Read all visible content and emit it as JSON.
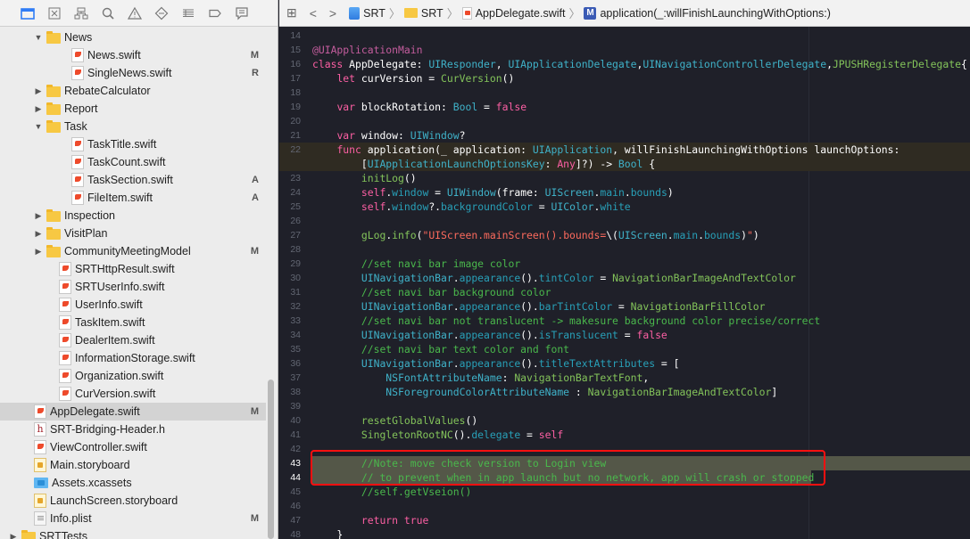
{
  "navigator": {
    "toolbar_icons": [
      {
        "name": "project-navigator-icon",
        "active": true
      },
      {
        "name": "source-control-navigator-icon",
        "active": false
      },
      {
        "name": "symbol-navigator-icon",
        "active": false
      },
      {
        "name": "find-navigator-icon",
        "active": false
      },
      {
        "name": "issue-navigator-icon",
        "active": false
      },
      {
        "name": "test-navigator-icon",
        "active": false
      },
      {
        "name": "debug-navigator-icon",
        "active": false
      },
      {
        "name": "breakpoint-navigator-icon",
        "active": false
      },
      {
        "name": "report-navigator-icon",
        "active": false
      }
    ],
    "items": [
      {
        "label": "News",
        "type": "folder",
        "indent": 1,
        "expanded": true,
        "status": ""
      },
      {
        "label": "News.swift",
        "type": "swift",
        "indent": 2,
        "status": "M"
      },
      {
        "label": "SingleNews.swift",
        "type": "swift",
        "indent": 2,
        "status": "R"
      },
      {
        "label": "RebateCalculator",
        "type": "folder",
        "indent": 1,
        "expanded": false,
        "status": ""
      },
      {
        "label": "Report",
        "type": "folder",
        "indent": 1,
        "expanded": false,
        "status": ""
      },
      {
        "label": "Task",
        "type": "folder",
        "indent": 1,
        "expanded": true,
        "status": ""
      },
      {
        "label": "TaskTitle.swift",
        "type": "swift",
        "indent": 2,
        "status": ""
      },
      {
        "label": "TaskCount.swift",
        "type": "swift",
        "indent": 2,
        "status": ""
      },
      {
        "label": "TaskSection.swift",
        "type": "swift",
        "indent": 2,
        "status": "A"
      },
      {
        "label": "FileItem.swift",
        "type": "swift",
        "indent": 2,
        "status": "A"
      },
      {
        "label": "Inspection",
        "type": "folder",
        "indent": 1,
        "expanded": false,
        "status": ""
      },
      {
        "label": "VisitPlan",
        "type": "folder",
        "indent": 1,
        "expanded": false,
        "status": ""
      },
      {
        "label": "CommunityMeetingModel",
        "type": "folder",
        "indent": 1,
        "expanded": false,
        "status": "M"
      },
      {
        "label": "SRTHttpResult.swift",
        "type": "swift",
        "indent": 1.5,
        "status": ""
      },
      {
        "label": "SRTUserInfo.swift",
        "type": "swift",
        "indent": 1.5,
        "status": ""
      },
      {
        "label": "UserInfo.swift",
        "type": "swift",
        "indent": 1.5,
        "status": ""
      },
      {
        "label": "TaskItem.swift",
        "type": "swift",
        "indent": 1.5,
        "status": ""
      },
      {
        "label": "DealerItem.swift",
        "type": "swift",
        "indent": 1.5,
        "status": ""
      },
      {
        "label": "InformationStorage.swift",
        "type": "swift",
        "indent": 1.5,
        "status": ""
      },
      {
        "label": "Organization.swift",
        "type": "swift",
        "indent": 1.5,
        "status": ""
      },
      {
        "label": "CurVersion.swift",
        "type": "swift",
        "indent": 1.5,
        "status": ""
      },
      {
        "label": "AppDelegate.swift",
        "type": "swift",
        "indent": 0.5,
        "status": "M",
        "selected": true
      },
      {
        "label": "SRT-Bridging-Header.h",
        "type": "header",
        "indent": 0.5,
        "status": ""
      },
      {
        "label": "ViewController.swift",
        "type": "swift",
        "indent": 0.5,
        "status": ""
      },
      {
        "label": "Main.storyboard",
        "type": "storyboard",
        "indent": 0.5,
        "status": ""
      },
      {
        "label": "Assets.xcassets",
        "type": "assets",
        "indent": 0.5,
        "status": ""
      },
      {
        "label": "LaunchScreen.storyboard",
        "type": "storyboard",
        "indent": 0.5,
        "status": ""
      },
      {
        "label": "Info.plist",
        "type": "plist",
        "indent": 0.5,
        "status": "M"
      },
      {
        "label": "SRTTests",
        "type": "folder",
        "indent": 0,
        "expanded": false,
        "status": ""
      }
    ]
  },
  "jump_bar": {
    "back": "<",
    "forward": ">",
    "crumbs": [
      {
        "label": "SRT",
        "icon": "project-icon"
      },
      {
        "label": "SRT",
        "icon": "folder-icon"
      },
      {
        "label": "AppDelegate.swift",
        "icon": "swift-file-icon"
      },
      {
        "label": "application(_:willFinishLaunchingWithOptions:)",
        "icon": "method-icon",
        "badge": "M"
      }
    ]
  },
  "editor": {
    "lines": [
      {
        "n": "14",
        "tokens": []
      },
      {
        "n": "15",
        "tokens": [
          [
            "at",
            "@UIApplicationMain"
          ]
        ]
      },
      {
        "n": "16",
        "tokens": [
          [
            "kw",
            "class"
          ],
          [
            "pl",
            " AppDelegate: "
          ],
          [
            "ty",
            "UIResponder"
          ],
          [
            "pl",
            ", "
          ],
          [
            "ty",
            "UIApplicationDelegate"
          ],
          [
            "pl",
            ","
          ],
          [
            "ty",
            "UINavigationControllerDelegate"
          ],
          [
            "pl",
            ","
          ],
          [
            "fn",
            "JPUSHRegisterDelegate"
          ],
          [
            "pl",
            "{"
          ]
        ]
      },
      {
        "n": "17",
        "tokens": [
          [
            "pl",
            "    "
          ],
          [
            "kw",
            "let"
          ],
          [
            "pl",
            " curVersion = "
          ],
          [
            "fn",
            "CurVersion"
          ],
          [
            "pl",
            "()"
          ]
        ]
      },
      {
        "n": "18",
        "tokens": []
      },
      {
        "n": "19",
        "tokens": [
          [
            "pl",
            "    "
          ],
          [
            "kw",
            "var"
          ],
          [
            "pl",
            " blockRotation: "
          ],
          [
            "ty",
            "Bool"
          ],
          [
            "pl",
            " = "
          ],
          [
            "kw",
            "false"
          ]
        ]
      },
      {
        "n": "20",
        "tokens": []
      },
      {
        "n": "21",
        "tokens": [
          [
            "pl",
            "    "
          ],
          [
            "kw",
            "var"
          ],
          [
            "pl",
            " window: "
          ],
          [
            "ty",
            "UIWindow"
          ],
          [
            "pl",
            "?"
          ]
        ]
      },
      {
        "n": "22",
        "current": true,
        "tokens": [
          [
            "pl",
            "    "
          ],
          [
            "kw",
            "func"
          ],
          [
            "pl",
            " application(_ application: "
          ],
          [
            "ty",
            "UIApplication"
          ],
          [
            "pl",
            ", willFinishLaunchingWithOptions launchOptions:"
          ]
        ]
      },
      {
        "n": "",
        "current": true,
        "tokens": [
          [
            "pl",
            "        ["
          ],
          [
            "ty",
            "UIApplicationLaunchOptionsKey"
          ],
          [
            "pl",
            ": "
          ],
          [
            "kw",
            "Any"
          ],
          [
            "pl",
            "]?) -> "
          ],
          [
            "ty",
            "Bool"
          ],
          [
            "pl",
            " {"
          ]
        ]
      },
      {
        "n": "23",
        "tokens": [
          [
            "pl",
            "        "
          ],
          [
            "fn",
            "initLog"
          ],
          [
            "pl",
            "()"
          ]
        ]
      },
      {
        "n": "24",
        "tokens": [
          [
            "pl",
            "        "
          ],
          [
            "kw",
            "self"
          ],
          [
            "pl",
            "."
          ],
          [
            "pr",
            "window"
          ],
          [
            "pl",
            " = "
          ],
          [
            "ty",
            "UIWindow"
          ],
          [
            "pl",
            "(frame: "
          ],
          [
            "ty",
            "UIScreen"
          ],
          [
            "pl",
            "."
          ],
          [
            "pr",
            "main"
          ],
          [
            "pl",
            "."
          ],
          [
            "pr",
            "bounds"
          ],
          [
            "pl",
            ")"
          ]
        ]
      },
      {
        "n": "25",
        "tokens": [
          [
            "pl",
            "        "
          ],
          [
            "kw",
            "self"
          ],
          [
            "pl",
            "."
          ],
          [
            "pr",
            "window"
          ],
          [
            "pl",
            "?."
          ],
          [
            "pr",
            "backgroundColor"
          ],
          [
            "pl",
            " = "
          ],
          [
            "ty",
            "UIColor"
          ],
          [
            "pl",
            "."
          ],
          [
            "pr",
            "white"
          ]
        ]
      },
      {
        "n": "26",
        "tokens": []
      },
      {
        "n": "27",
        "tokens": [
          [
            "pl",
            "        "
          ],
          [
            "fn",
            "gLog"
          ],
          [
            "pl",
            "."
          ],
          [
            "fn",
            "info"
          ],
          [
            "pl",
            "("
          ],
          [
            "st",
            "\"UIScreen.mainScreen().bounds="
          ],
          [
            "pl",
            "\\("
          ],
          [
            "ty",
            "UIScreen"
          ],
          [
            "pl",
            "."
          ],
          [
            "pr",
            "main"
          ],
          [
            "pl",
            "."
          ],
          [
            "pr",
            "bounds"
          ],
          [
            "pl",
            ")"
          ],
          [
            "st",
            "\""
          ],
          [
            "pl",
            ")"
          ]
        ]
      },
      {
        "n": "28",
        "tokens": []
      },
      {
        "n": "29",
        "tokens": [
          [
            "pl",
            "        "
          ],
          [
            "cm",
            "//set navi bar image color"
          ]
        ]
      },
      {
        "n": "30",
        "tokens": [
          [
            "pl",
            "        "
          ],
          [
            "ty",
            "UINavigationBar"
          ],
          [
            "pl",
            "."
          ],
          [
            "pr",
            "appearance"
          ],
          [
            "pl",
            "()."
          ],
          [
            "pr",
            "tintColor"
          ],
          [
            "pl",
            " = "
          ],
          [
            "fn",
            "NavigationBarImageAndTextColor"
          ]
        ]
      },
      {
        "n": "31",
        "tokens": [
          [
            "pl",
            "        "
          ],
          [
            "cm",
            "//set navi bar background color"
          ]
        ]
      },
      {
        "n": "32",
        "tokens": [
          [
            "pl",
            "        "
          ],
          [
            "ty",
            "UINavigationBar"
          ],
          [
            "pl",
            "."
          ],
          [
            "pr",
            "appearance"
          ],
          [
            "pl",
            "()."
          ],
          [
            "pr",
            "barTintColor"
          ],
          [
            "pl",
            " = "
          ],
          [
            "fn",
            "NavigationBarFillColor"
          ]
        ]
      },
      {
        "n": "33",
        "tokens": [
          [
            "pl",
            "        "
          ],
          [
            "cm",
            "//set navi bar not translucent -> makesure background color precise/correct"
          ]
        ]
      },
      {
        "n": "34",
        "tokens": [
          [
            "pl",
            "        "
          ],
          [
            "ty",
            "UINavigationBar"
          ],
          [
            "pl",
            "."
          ],
          [
            "pr",
            "appearance"
          ],
          [
            "pl",
            "()."
          ],
          [
            "pr",
            "isTranslucent"
          ],
          [
            "pl",
            " = "
          ],
          [
            "kw",
            "false"
          ]
        ]
      },
      {
        "n": "35",
        "tokens": [
          [
            "pl",
            "        "
          ],
          [
            "cm",
            "//set navi bar text color and font"
          ]
        ]
      },
      {
        "n": "36",
        "tokens": [
          [
            "pl",
            "        "
          ],
          [
            "ty",
            "UINavigationBar"
          ],
          [
            "pl",
            "."
          ],
          [
            "pr",
            "appearance"
          ],
          [
            "pl",
            "()."
          ],
          [
            "pr",
            "titleTextAttributes"
          ],
          [
            "pl",
            " = ["
          ]
        ]
      },
      {
        "n": "37",
        "tokens": [
          [
            "pl",
            "            "
          ],
          [
            "ty",
            "NSFontAttributeName"
          ],
          [
            "pl",
            ": "
          ],
          [
            "fn",
            "NavigationBarTextFont"
          ],
          [
            "pl",
            ","
          ]
        ]
      },
      {
        "n": "38",
        "tokens": [
          [
            "pl",
            "            "
          ],
          [
            "ty",
            "NSForegroundColorAttributeName"
          ],
          [
            "pl",
            " : "
          ],
          [
            "fn",
            "NavigationBarImageAndTextColor"
          ],
          [
            "pl",
            "]"
          ]
        ]
      },
      {
        "n": "39",
        "tokens": []
      },
      {
        "n": "40",
        "tokens": [
          [
            "pl",
            "        "
          ],
          [
            "fn",
            "resetGlobalValues"
          ],
          [
            "pl",
            "()"
          ]
        ]
      },
      {
        "n": "41",
        "tokens": [
          [
            "pl",
            "        "
          ],
          [
            "fn",
            "SingletonRootNC"
          ],
          [
            "pl",
            "()."
          ],
          [
            "pr",
            "delegate"
          ],
          [
            "pl",
            " = "
          ],
          [
            "kw",
            "self"
          ]
        ]
      },
      {
        "n": "42",
        "tokens": []
      },
      {
        "n": "43",
        "selected": "full",
        "tokens": [
          [
            "pl",
            "        "
          ],
          [
            "cm",
            "//Note: move check version to Login view"
          ]
        ]
      },
      {
        "n": "44",
        "selected": "partial",
        "tokens": [
          [
            "pl",
            "        "
          ],
          [
            "cm",
            "// to prevent when in app launch but no network, app will crash or stopped"
          ]
        ]
      },
      {
        "n": "45",
        "tokens": [
          [
            "pl",
            "        "
          ],
          [
            "cm",
            "//self.getVseion()"
          ]
        ]
      },
      {
        "n": "46",
        "tokens": []
      },
      {
        "n": "47",
        "tokens": [
          [
            "pl",
            "        "
          ],
          [
            "kw",
            "return"
          ],
          [
            "pl",
            " "
          ],
          [
            "kw",
            "true"
          ]
        ]
      },
      {
        "n": "48",
        "tokens": [
          [
            "pl",
            "    }"
          ]
        ]
      }
    ]
  },
  "colors": {
    "editor_bg": "#1f2029",
    "keyword": "#fc5fa3",
    "type": "#3fb2c9",
    "comment": "#4ab84c",
    "string": "#fc6a5d",
    "annotation_box": "#ff1010",
    "selection": "#545748"
  }
}
